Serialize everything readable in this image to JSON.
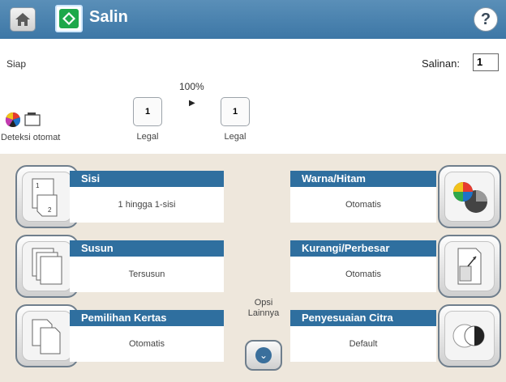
{
  "header": {
    "title": "Salin"
  },
  "status": {
    "text": "Siap"
  },
  "copies": {
    "label": "Salinan:",
    "value": "1"
  },
  "preview": {
    "zoom": "100%",
    "detect_label": "Deteksi otomat",
    "source": {
      "page": "1",
      "size": "Legal"
    },
    "output": {
      "page": "1",
      "size": "Legal"
    }
  },
  "tiles": {
    "sides": {
      "title": "Sisi",
      "value": "1 hingga 1-sisi"
    },
    "collate": {
      "title": "Susun",
      "value": "Tersusun"
    },
    "paper": {
      "title": "Pemilihan Kertas",
      "value": "Otomatis"
    },
    "color": {
      "title": "Warna/Hitam",
      "value": "Otomatis"
    },
    "reduce": {
      "title": "Kurangi/Perbesar",
      "value": "Otomatis"
    },
    "image": {
      "title": "Penyesuaian Citra",
      "value": "Default"
    }
  },
  "more_options": {
    "label_line1": "Opsi",
    "label_line2": "Lainnya"
  },
  "icons": [
    "home-icon",
    "copy-icon",
    "help-icon",
    "color-detect-icon",
    "document-icon",
    "two-sided-icon",
    "collate-icon",
    "paper-select-icon",
    "color-mode-icon",
    "resize-icon",
    "image-adjust-icon",
    "chevron-down-icon"
  ]
}
